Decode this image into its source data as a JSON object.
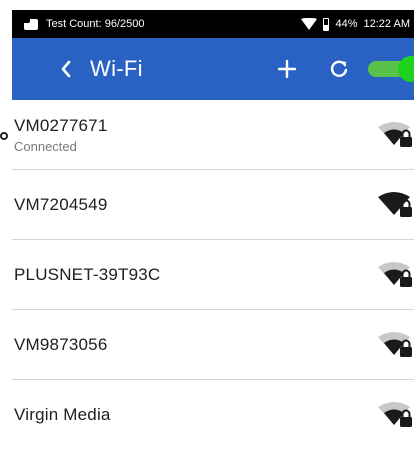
{
  "status_bar": {
    "test_count": "Test Count: 96/2500",
    "battery": "44%",
    "time": "12:22 AM"
  },
  "app_bar": {
    "title": "Wi-Fi",
    "toggle_on": true,
    "bar_color": "#2a62c4",
    "toggle_color": "#1fd21f"
  },
  "networks": [
    {
      "ssid": "VM0277671",
      "status": "Connected",
      "signal": "strong",
      "secured": true
    },
    {
      "ssid": "VM7204549",
      "status": "",
      "signal": "full",
      "secured": true
    },
    {
      "ssid": "PLUSNET-39T93C",
      "status": "",
      "signal": "strong",
      "secured": true
    },
    {
      "ssid": "VM9873056",
      "status": "",
      "signal": "strong",
      "secured": true
    },
    {
      "ssid": "Virgin Media",
      "status": "",
      "signal": "strong",
      "secured": true
    }
  ]
}
